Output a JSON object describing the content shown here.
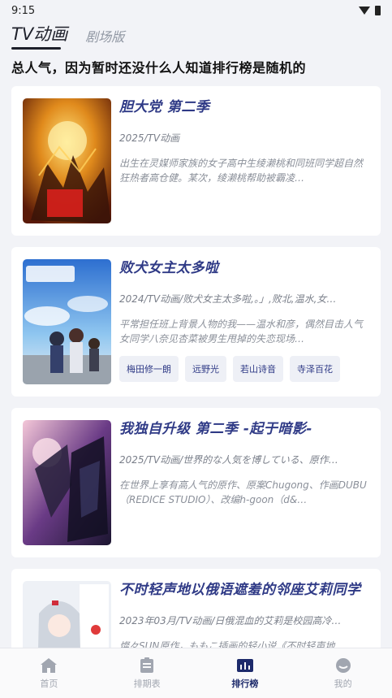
{
  "status": {
    "time": "9:15"
  },
  "tabs": [
    {
      "label": "TV动画",
      "active": true
    },
    {
      "label": "剧场版",
      "active": false
    }
  ],
  "subtitle": "总人气，因为暂时还没什么人知道排行榜是随机的",
  "cards": [
    {
      "title": "胆大党 第二季",
      "meta": "2025/TV动画",
      "desc": "出生在灵媒师家族的女子高中生绫濑桃和同班同学超自然狂热者高仓健。某次，绫濑桃帮助被霸凌…",
      "chips": []
    },
    {
      "title": "败犬女主太多啦",
      "meta": "2024/TV动画/败犬女主太多啦,。」,败北,温水,女…",
      "desc": "平常担任班上背景人物的我——温水和彦，偶然目击人气女同学八奈见杏菜被男生甩掉的失恋现场…",
      "chips": [
        "梅田修一朗",
        "远野光",
        "若山诗音",
        "寺泽百花"
      ]
    },
    {
      "title": "我独自升级 第二季 -起于暗影-",
      "meta": "2025/TV动画/世界的な人気を博している、原作…",
      "desc": "在世界上享有高人气的原作、原案Chugong、作画DUBU（REDICE STUDIO）、改编h-goon（d&…",
      "chips": []
    },
    {
      "title": "不时轻声地以俄语遮羞的邻座艾莉同学",
      "meta": "2023年03月/TV动画/日俄混血的艾莉是校园高冷…",
      "desc": "燦々SUN原作，ももこ插画的轻小说《不时轻声地…",
      "chips": []
    }
  ],
  "nav": [
    {
      "label": "首页",
      "icon": "home-icon",
      "active": false
    },
    {
      "label": "排期表",
      "icon": "schedule-icon",
      "active": false
    },
    {
      "label": "排行榜",
      "icon": "ranking-icon",
      "active": true
    },
    {
      "label": "我的",
      "icon": "profile-icon",
      "active": false
    }
  ]
}
